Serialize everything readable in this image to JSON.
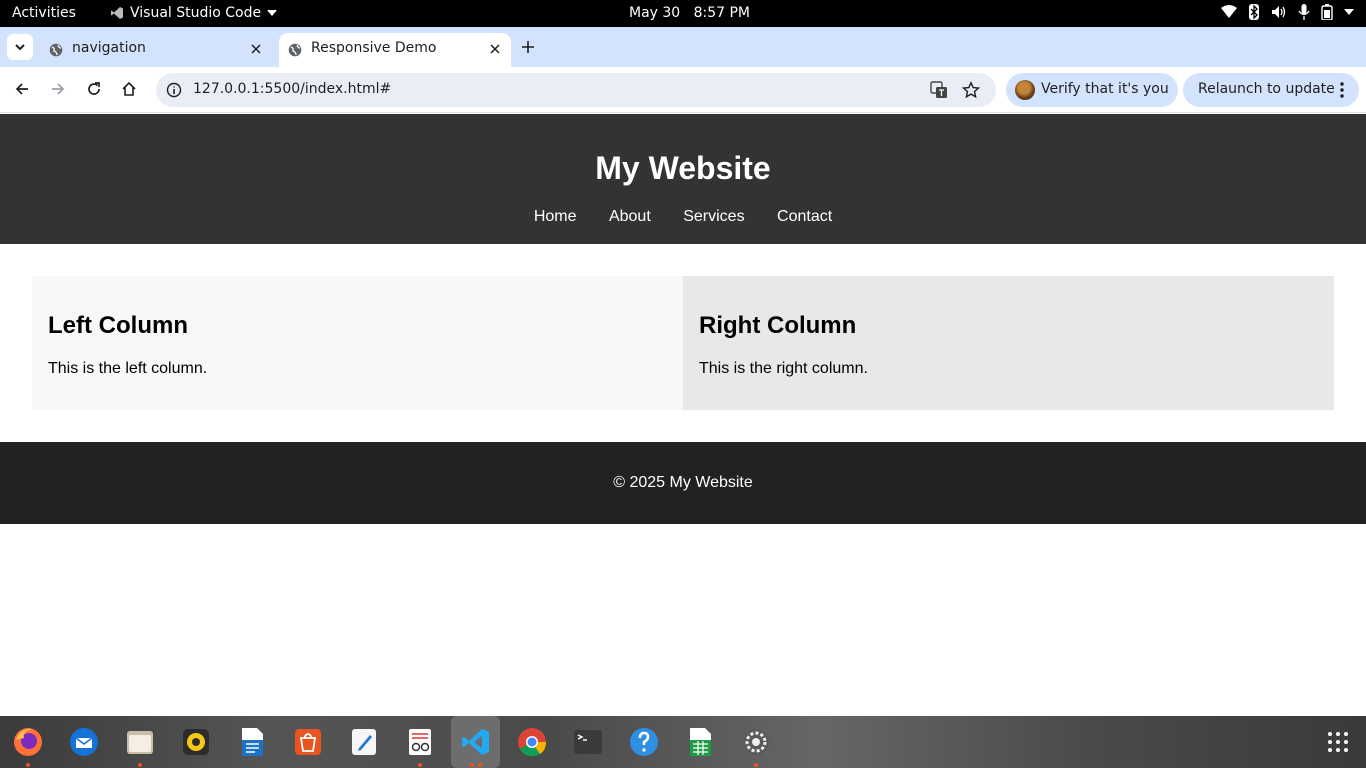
{
  "system_bar": {
    "activities": "Activities",
    "app_name": "Visual Studio Code",
    "date": "May 30",
    "time": "8:57 PM"
  },
  "browser": {
    "tabs": [
      {
        "title": "navigation",
        "active": false
      },
      {
        "title": "Responsive Demo",
        "active": true
      }
    ],
    "url": "127.0.0.1:5500/index.html#",
    "verify_chip": "Verify that it's you",
    "relaunch_chip": "Relaunch to update"
  },
  "page": {
    "header": {
      "title": "My Website",
      "nav": [
        "Home",
        "About",
        "Services",
        "Contact"
      ]
    },
    "left_column": {
      "heading": "Left Column",
      "text": "This is the left column."
    },
    "right_column": {
      "heading": "Right Column",
      "text": "This is the right column."
    },
    "footer": "© 2025 My Website"
  },
  "dock": {
    "apps": [
      "firefox-icon",
      "thunderbird-icon",
      "files-icon",
      "rhythmbox-icon",
      "writer-icon",
      "app-center-icon",
      "text-editor-icon",
      "document-viewer-icon",
      "vscode-icon",
      "chrome-icon",
      "terminal-icon",
      "help-icon",
      "calc-icon",
      "settings-icon"
    ]
  },
  "colors": {
    "header_bg": "#333333",
    "footer_bg": "#222222",
    "left_col_bg": "#f8f8f8",
    "right_col_bg": "#e8e8e8",
    "tabstrip_bg": "#d3e3fd"
  }
}
